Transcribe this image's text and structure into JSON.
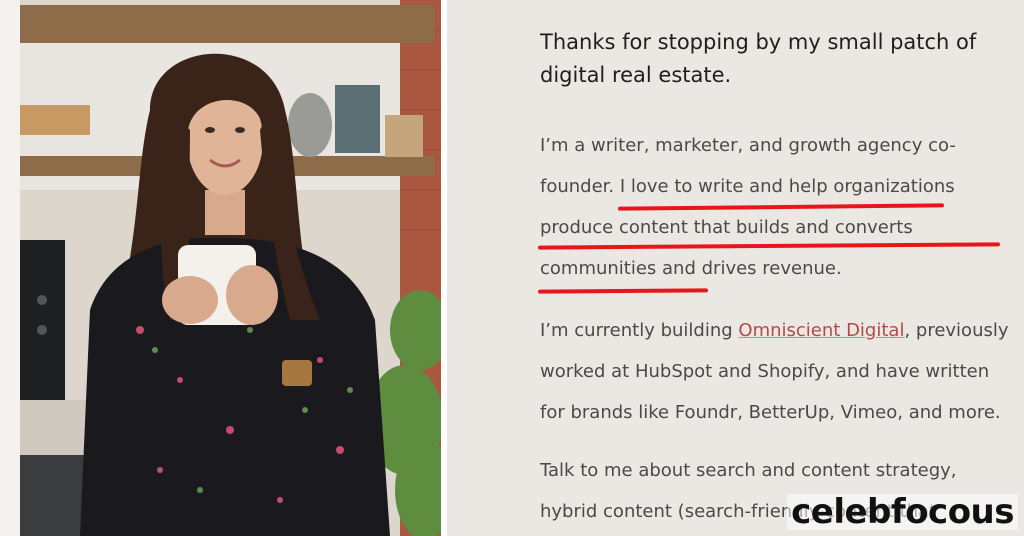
{
  "intro": "Thanks for stopping by my small patch of digital real estate.",
  "paragraph1": {
    "prefix": "I’m a writer, marketer, and growth agency co-founder. ",
    "highlight": "I love to write and help organizations produce content that builds and converts communities and drives revenue."
  },
  "paragraph2": {
    "before": "I’m currently building ",
    "link": "Omniscient Digital",
    "after": ", previously worked at HubSpot and Shopify, and have written for brands like Foundr, BetterUp, Vimeo, and more."
  },
  "paragraph3": "Talk to me about search and content strategy, hybrid content (search-friendly content that",
  "watermark": "celebfocous",
  "colors": {
    "highlight_underline": "#e8161b",
    "link": "#b44a4a",
    "background": "#ebe7e3"
  }
}
